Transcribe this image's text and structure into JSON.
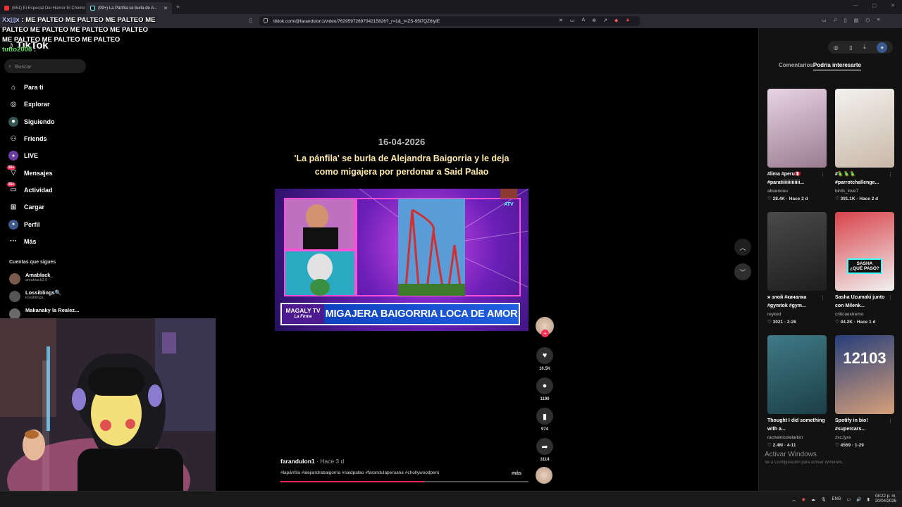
{
  "browser": {
    "tabs": [
      {
        "label": "(651) El Especial Del Humor El Chomo",
        "active": false
      },
      {
        "label": "(99+) La Pánfila se burla de A...",
        "active": true
      }
    ],
    "url": "tiktok.com/@farandulon1/video/7629597269704215826?_r=1&_t=ZS-95i7QZ6lylE"
  },
  "chat": {
    "line1_user": "Xxjjjx",
    "line1_text": ": ME PALTEO ME PALTEO ME PALTEO ME PALTEO ME PALTEO ME PALTEO ME PALTEO ME PALTEO ME PALTEO ME PALTEO",
    "line2_user": "tutto2008",
    "line2_text": ":"
  },
  "sidebar": {
    "logo": "TikTok",
    "search_placeholder": "Buscar",
    "items": [
      {
        "label": "Para ti",
        "icon": "home-icon"
      },
      {
        "label": "Explorar",
        "icon": "compass-icon"
      },
      {
        "label": "Siguiendo",
        "icon": "following-icon"
      },
      {
        "label": "Friends",
        "icon": "friends-icon"
      },
      {
        "label": "LIVE",
        "icon": "live-icon"
      },
      {
        "label": "Mensajes",
        "icon": "messages-icon",
        "badge": "99+"
      },
      {
        "label": "Actividad",
        "icon": "activity-icon",
        "badge": "99+"
      },
      {
        "label": "Cargar",
        "icon": "upload-icon"
      },
      {
        "label": "Perfil",
        "icon": "profile-icon"
      },
      {
        "label": "Más",
        "icon": "more-icon"
      }
    ],
    "following_title": "Cuentas que sigues",
    "following": [
      {
        "name": "Amablack_",
        "handle": "amablack2.0"
      },
      {
        "name": "Lossiblings🔍",
        "handle": "lossiblings_"
      },
      {
        "name": "Makanaky la Realez...",
        "handle": ""
      }
    ]
  },
  "video": {
    "date_overlay": "16-04-2026",
    "title_overlay": "'La pánfila' se burla de Alejandra Baigorria y le deja como migajera por perdonar a Said Palao",
    "chyron_logo_1": "MAGALY TV",
    "chyron_logo_2": "La Firme",
    "chyron_text": "MIGAJERA BAIGORRIA LOCA DE AMOR",
    "author": "farandulon1",
    "ago": " · Hace 3 d",
    "description": "#lapánfila #alejandrabaigorria #saidpalao #farandulaperuana #chollywoodperú",
    "more_label": "más",
    "progress": 0.58
  },
  "actions": {
    "likes": "16.5K",
    "comments": "1190",
    "saves": "974",
    "shares": "3114"
  },
  "right_panel": {
    "tabs": [
      {
        "label": "Comentarios",
        "active": false
      },
      {
        "label": "Podría interesarte",
        "active": true
      }
    ],
    "cards": [
      {
        "title": "#lima #peru🇵🇪 #paratiiiiiiiiiiiii...",
        "author": "abuenouu",
        "stats": "♡ 28.4K · Hace 2 d",
        "colors": [
          "#e7d4e4",
          "#9a7b8f"
        ]
      },
      {
        "title": "#🦜🦜🦜 #parrotchallenge...",
        "author": "birds_love7",
        "stats": "♡ 391.1K · Hace 2 d",
        "colors": [
          "#f3f1ee",
          "#c9b8a8"
        ]
      },
      {
        "title": "я злой #качалка #gymtok #gym...",
        "author": "reyked",
        "stats": "♡ 3021 · 2-26",
        "colors": [
          "#4a4a4a",
          "#1e1e1e"
        ]
      },
      {
        "title": "Sasha Uzumaki junto con Milenk...",
        "author": "criticaextremo",
        "stats": "♡ 44.2K · Hace 1 d",
        "colors": [
          "#d8434a",
          "#f1f1f1"
        ]
      },
      {
        "title": "Thought I did something with a...",
        "author": "rachelnicolelarkin",
        "stats": "♡ 2.4M · 4-11",
        "colors": [
          "#3f7a86",
          "#1c3f48"
        ]
      },
      {
        "title": "Spotify in bio! #supercars...",
        "author": "zxc.lyxx",
        "stats": "♡ 4569 · 1-29",
        "colors": [
          "#263e7a",
          "#d7a07a"
        ]
      }
    ],
    "sasha_overlay": "SASHA ¿QUÉ PASÓ?",
    "number_overlay": "12103"
  },
  "windows": {
    "activate": "Activar Windows",
    "activate_sub": "Ve a Configuración para activar Windows.",
    "lang": "ENG",
    "time": "08:22 p. m.",
    "date": "20/04/2026"
  }
}
